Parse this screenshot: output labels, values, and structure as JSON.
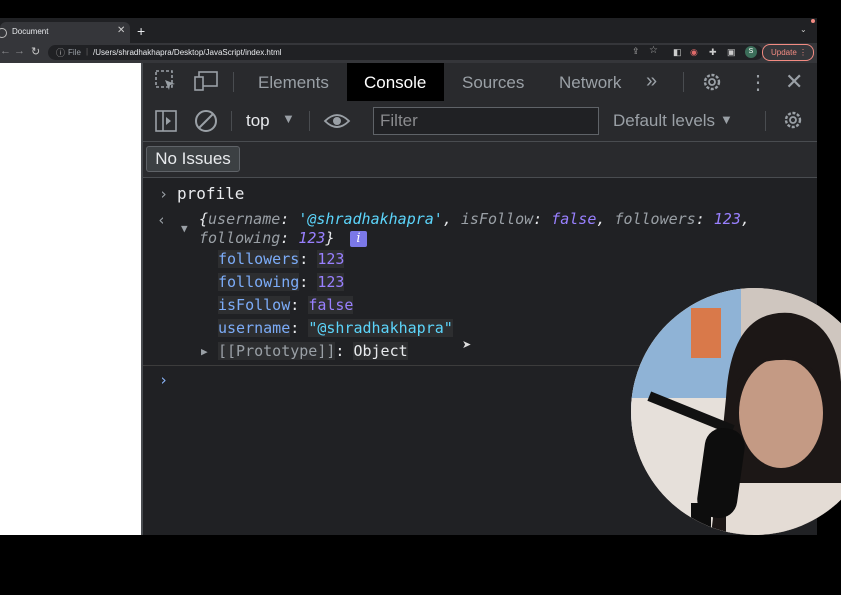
{
  "browser": {
    "tab_title": "Document",
    "url_scheme": "File",
    "url": "/Users/shradhakhapra/Desktop/JavaScript/index.html",
    "profile_initial": "S",
    "update_label": "Update"
  },
  "devtools": {
    "tabs": [
      "Elements",
      "Console",
      "Sources",
      "Network"
    ],
    "active_tab": "Console",
    "context": "top",
    "filter_placeholder": "Filter",
    "levels": "Default levels",
    "issues": "No Issues"
  },
  "console": {
    "input": "profile",
    "summary": {
      "username_key": "username",
      "username_val": "'@shradhakhapra'",
      "isFollow_key": "isFollow",
      "isFollow_val": "false",
      "followers_key": "followers",
      "followers_val": "123",
      "following_key": "following",
      "following_val": "123"
    },
    "props": [
      {
        "key": "followers",
        "value": "123"
      },
      {
        "key": "following",
        "value": "123"
      },
      {
        "key": "isFollow",
        "value": "false"
      },
      {
        "key": "username",
        "value": "\"@shradhakhapra\""
      }
    ],
    "prototype_key": "[[Prototype]]",
    "prototype_val": "Object"
  },
  "colors": {
    "accent": "#8ab4f8",
    "key": "#7cacf8",
    "number": "#9980ff",
    "string": "#5cd5fb",
    "update": "#f28b82"
  },
  "icons": [
    "inspect-icon",
    "device-toolbar-icon",
    "more-tabs-icon",
    "settings-icon",
    "kebab-icon",
    "close-icon",
    "sidebar-icon",
    "clear-icon",
    "eye-icon",
    "info-icon"
  ]
}
